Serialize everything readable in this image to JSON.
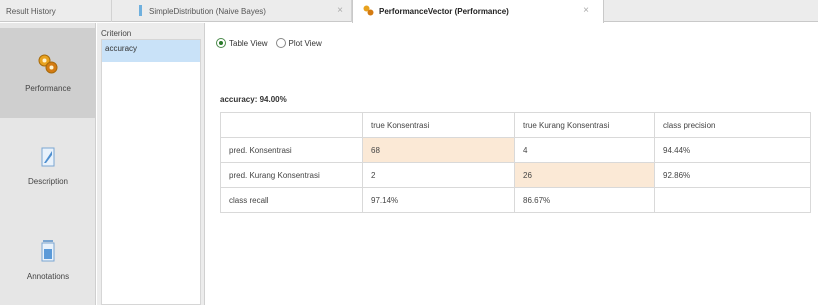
{
  "tabs": {
    "result_history": "Result History",
    "simple_distribution": "SimpleDistribution (Naive Bayes)",
    "performance_vector": "PerformanceVector (Performance)",
    "close_symbol": "×"
  },
  "sidebar": {
    "items": [
      {
        "label": "Performance",
        "icon": "performance-icon"
      },
      {
        "label": "Description",
        "icon": "description-icon"
      },
      {
        "label": "Annotations",
        "icon": "annotations-icon"
      }
    ]
  },
  "criterion": {
    "header": "Criterion",
    "items": [
      "accuracy"
    ]
  },
  "view_toggle": {
    "table_view": "Table View",
    "plot_view": "Plot View",
    "selected": "Table View"
  },
  "accuracy_label": "accuracy: 94.00%",
  "confusion_matrix": {
    "headers": [
      "",
      "true Konsentrasi",
      "true Kurang Konsentrasi",
      "class precision"
    ],
    "rows": [
      [
        "pred. Konsentrasi",
        "68",
        "4",
        "94.44%"
      ],
      [
        "pred. Kurang Konsentrasi",
        "2",
        "26",
        "92.86%"
      ],
      [
        "class recall",
        "97.14%",
        "86.67%",
        ""
      ]
    ]
  },
  "colors": {
    "highlight_cell": "#fbe9d6",
    "selected_criterion": "#c9e2f8",
    "sidebar_active": "#cfcfcf"
  }
}
